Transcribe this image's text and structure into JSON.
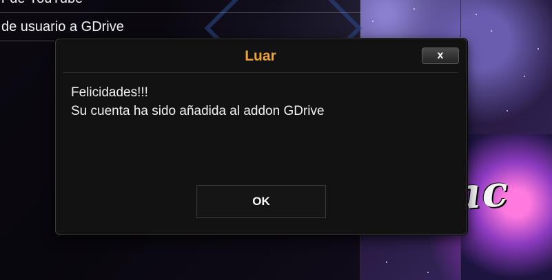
{
  "background_list": {
    "items": [
      {
        "label": "r de YouTube"
      },
      {
        "label": "de usuario a GDrive"
      }
    ]
  },
  "dialog": {
    "title": "Luar",
    "close_label": "x",
    "message_lines": [
      "Felicidades!!!",
      "Su cuenta ha sido añadida al addon GDrive"
    ],
    "ok_label": "OK"
  },
  "watermark": {
    "text": "Maniac"
  },
  "colors": {
    "title_accent": "#eba33a",
    "dialog_bg": "#121212",
    "text": "#f2f2f2"
  }
}
